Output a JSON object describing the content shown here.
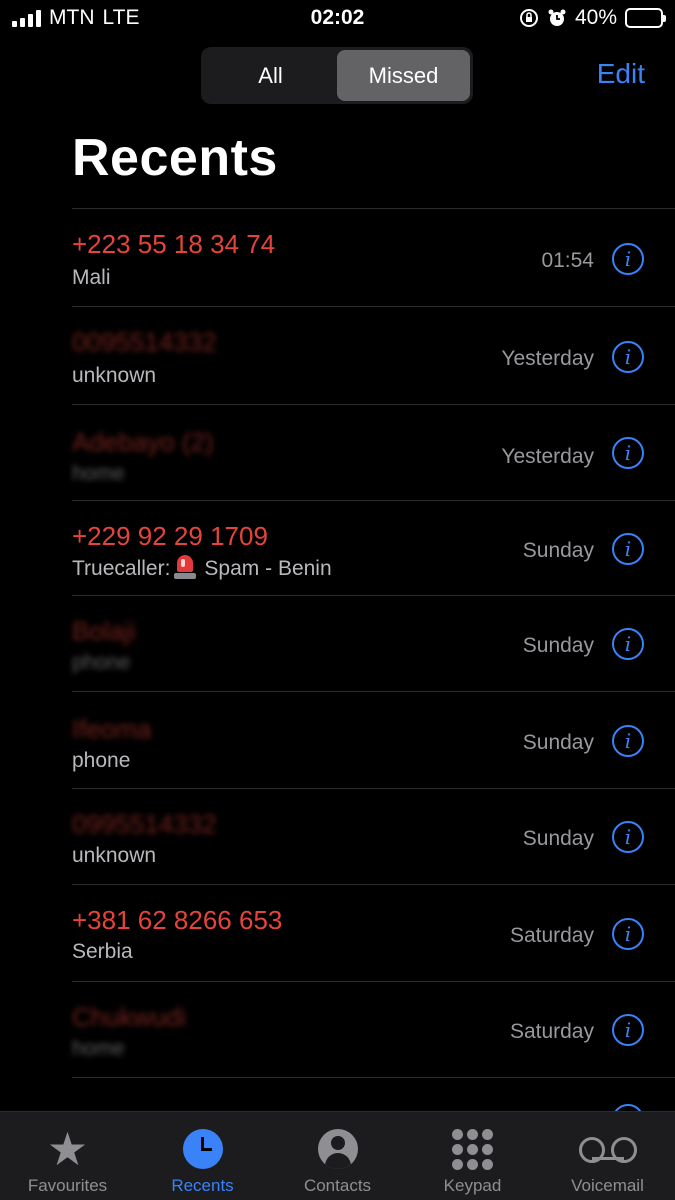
{
  "status_bar": {
    "carrier": "MTN",
    "network": "LTE",
    "time": "02:02",
    "battery": "40%",
    "battery_level": 0.4
  },
  "segmented": {
    "all": "All",
    "missed": "Missed",
    "selected": "Missed"
  },
  "edit_label": "Edit",
  "title": "Recents",
  "calls": [
    {
      "name": "+223 55 18 34 74",
      "sub": "Mali",
      "when": "01:54",
      "obscured": false
    },
    {
      "name": "0095514332",
      "sub": "unknown",
      "when": "Yesterday",
      "obscured": true
    },
    {
      "name": "Adebayo (2)",
      "sub": "home",
      "when": "Yesterday",
      "obscured": true
    },
    {
      "name": "+229 92 29 1709",
      "sub_prefix": "Truecaller:",
      "sub": "Spam - Benin",
      "when": "Sunday",
      "obscured": false
    },
    {
      "name": "Bolaji",
      "sub": "phone",
      "when": "Sunday",
      "obscured": true
    },
    {
      "name": "Ifeoma",
      "sub": "phone",
      "when": "Sunday",
      "obscured": true
    },
    {
      "name": "0995514332",
      "sub": "unknown",
      "when": "Sunday",
      "obscured": true
    },
    {
      "name": "+381 62 8266 653",
      "sub": "Serbia",
      "when": "Saturday",
      "obscured": false
    },
    {
      "name": "Chukwudi",
      "sub": "home",
      "when": "Saturday",
      "obscured": true
    }
  ],
  "tabs": [
    {
      "label": "Favourites",
      "icon": "star-icon",
      "active": false
    },
    {
      "label": "Recents",
      "icon": "clock-icon",
      "active": true
    },
    {
      "label": "Contacts",
      "icon": "person-icon",
      "active": false
    },
    {
      "label": "Keypad",
      "icon": "keypad-icon",
      "active": false
    },
    {
      "label": "Voicemail",
      "icon": "voicemail-icon",
      "active": false
    }
  ],
  "colors": {
    "missed_red": "#e5443b",
    "accent_blue": "#3a82f7",
    "background": "#000000"
  }
}
